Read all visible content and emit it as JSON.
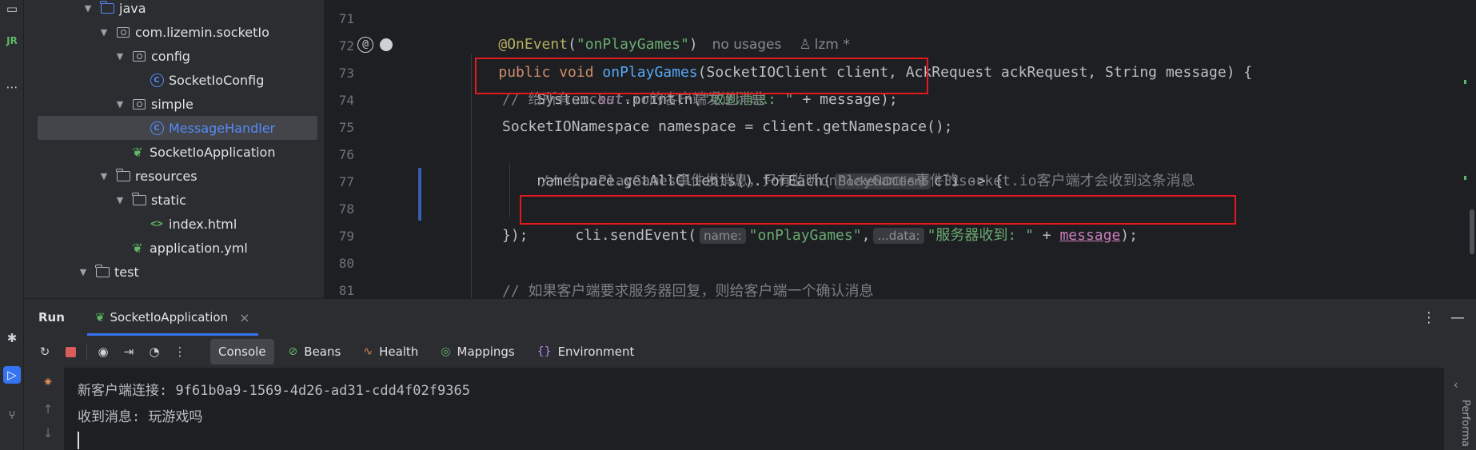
{
  "strip": {
    "icons": [
      "structure-icon",
      "jrebel-icon",
      "more-icon",
      "debug-icon",
      "run-icon",
      "git-icon"
    ]
  },
  "tree": {
    "items": [
      {
        "label": "java",
        "kind": "folder-blue",
        "depth": 3,
        "expanded": true
      },
      {
        "label": "com.lizemin.socketIo",
        "kind": "package",
        "depth": 4,
        "expanded": true
      },
      {
        "label": "config",
        "kind": "package",
        "depth": 5,
        "expanded": true
      },
      {
        "label": "SocketIoConfig",
        "kind": "class",
        "depth": 6,
        "expanded": null
      },
      {
        "label": "simple",
        "kind": "package",
        "depth": 5,
        "expanded": true
      },
      {
        "label": "MessageHandler",
        "kind": "class",
        "depth": 6,
        "expanded": null,
        "selected": true
      },
      {
        "label": "SocketIoApplication",
        "kind": "spring",
        "depth": 5,
        "expanded": null
      },
      {
        "label": "resources",
        "kind": "folder",
        "depth": 3,
        "expanded": true
      },
      {
        "label": "static",
        "kind": "folder",
        "depth": 4,
        "expanded": true
      },
      {
        "label": "index.html",
        "kind": "html",
        "depth": 5,
        "expanded": null
      },
      {
        "label": "application.yml",
        "kind": "spring",
        "depth": 4,
        "expanded": null
      },
      {
        "label": "test",
        "kind": "folder",
        "depth": 2,
        "expanded": true
      }
    ]
  },
  "editor": {
    "line_numbers": [
      "71",
      "72",
      "73",
      "74",
      "75",
      "76",
      "77",
      "78",
      "79",
      "80",
      "81"
    ],
    "annotation": "@OnEvent",
    "annotation_arg": "\"onPlayGames\"",
    "usages": "no usages",
    "author": "lzm *",
    "l72_kw": "public void",
    "l72_fn": "onPlayGames",
    "l72_params": "(SocketIOClient client, AckRequest ackRequest, String message) {",
    "l73_a": "System.",
    "l73_out": "out",
    "l73_b": ".println(",
    "l73_str": "\"收到消息: \"",
    "l73_c": " + message);",
    "l74": "// 给所有socket-io的客户端发送消息",
    "l75": "SocketIONamespace namespace = client.getNamespace();",
    "l76_a": "namespace.getAllClients().forEach(",
    "l76_hint": "SocketIOClient",
    "l76_b": "cli -> {",
    "l77": "// 给onPlayGames事件发消息，只有监听onPlayGames事件的socket.io客户端才会收到这条消息",
    "l78_a": "cli.sendEvent(",
    "l78_hint1": "name:",
    "l78_str1": "\"onPlayGames\"",
    "l78_comma": ",",
    "l78_hint2": "...data:",
    "l78_str2": "\"服务器收到: \"",
    "l78_plus": " + ",
    "l78_param": "message",
    "l78_end": ");",
    "l79": "});",
    "l81": "// 如果客户端要求服务器回复，则给客户端一个确认消息"
  },
  "run": {
    "title": "Run",
    "tab_label": "SocketIoApplication",
    "close": "×",
    "tabs": [
      "Console",
      "Beans",
      "Health",
      "Mappings",
      "Environment"
    ],
    "console_lines": [
      "新客户端连接: 9f61b0a9-1569-4d26-ad31-cdd4f02f9365",
      "收到消息: 玩游戏吗"
    ],
    "side_label": "Performa"
  },
  "colors": {
    "highlight_box": "#e5181e",
    "accent": "#3574f0"
  }
}
